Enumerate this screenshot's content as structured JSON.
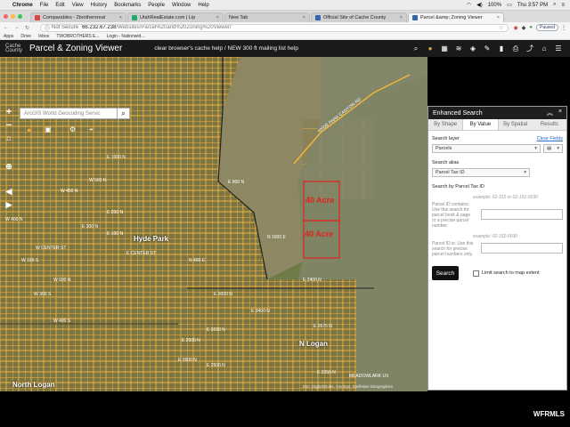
{
  "os_menu": {
    "app": "Chrome",
    "items": [
      "File",
      "Edit",
      "View",
      "History",
      "Bookmarks",
      "People",
      "Window",
      "Help"
    ],
    "battery": "100%",
    "clock": "Thu 3:57 PM"
  },
  "browser": {
    "tabs": [
      {
        "label": "Comparables - 2brothersreal",
        "color": "#d44"
      },
      {
        "label": "UtahRealEstate.com | Lip",
        "color": "#2a6"
      },
      {
        "label": "New Tab",
        "color": "#888"
      },
      {
        "label": "Official Site of Cache County",
        "color": "#36a"
      },
      {
        "label": "Parcel &amp; Zoning Viewer",
        "color": "#36a"
      }
    ],
    "not_secure": "Not Secure",
    "url_host": "66.232.67.238",
    "url_path": "/Websites/Parcel%20and%20Zoning%20Viewer/",
    "paused": "Paused",
    "bookmarks": [
      "Apps",
      "Drive",
      "Inbox",
      "TWOBROTHERS E...",
      "Login - Nationwid..."
    ]
  },
  "app": {
    "logo_line1": "Cache",
    "logo_line2": "County",
    "title": "Parcel & Zoning Viewer",
    "header_links": "clear browser's cache help /   NEW 300 ft mailing list help"
  },
  "map": {
    "geocode_placeholder": "ArcGIS World Geocoding Servic",
    "zoom_in": "+",
    "zoom_out": "−",
    "town_label": "Hyde Park",
    "north_logan_label": "North Logan",
    "logan_label": "N Logan",
    "parcel_label_1": "40 Acre",
    "parcel_label_2": "40 Acre",
    "road_label": "HYDE PARK CANYON RD",
    "attribution": "Esri, DigitalGlobe, GeoEye, Earthstar Geographics",
    "street_labels": [
      "E 300 N",
      "E 200 N",
      "E 100 N",
      "W CENTER ST",
      "E CENTER ST",
      "W 100 S",
      "W 300 S",
      "W 400 S",
      "E 1000 N",
      "E 900 N",
      "E 2400 N",
      "E 3400 N",
      "E 3100 N",
      "E 2900 N",
      "E 2675 N",
      "E 2600 N",
      "E 2500 N",
      "E 2350 N",
      "E 3000 N",
      "MEADOWLARK LN",
      "N 1000 E",
      "N 400 E",
      "W 450 N",
      "W 500 N",
      "W 400 N",
      "W 600 N"
    ]
  },
  "panel": {
    "title": "Enhanced Search",
    "tabs": [
      "By Shape",
      "By Value",
      "By Spatial",
      "Results"
    ],
    "search_layer_label": "Search layer",
    "clear_fields": "Clear Fields",
    "layer_value": "Parcels",
    "search_alias_label": "Search alias",
    "alias_value": "Parcel Tax ID",
    "search_by_label": "Search by Parcel Tax ID",
    "example1": "example: 02-152 or 02-152-0030",
    "desc1": "Parcel ID contains: Use this search for parcel book & page or a precise parcel number.",
    "example2": "example: 02-152-0030",
    "desc2": "Parcel ID is: Use this search for precise parcel numbers only.",
    "search_button": "Search",
    "limit_label": "Limit search to map extent"
  },
  "watermark": "WFRMLS",
  "colors": {
    "parcel_line": "#f2b43a",
    "highlight": "#e0231d",
    "panel_header": "#1f1f1f"
  }
}
